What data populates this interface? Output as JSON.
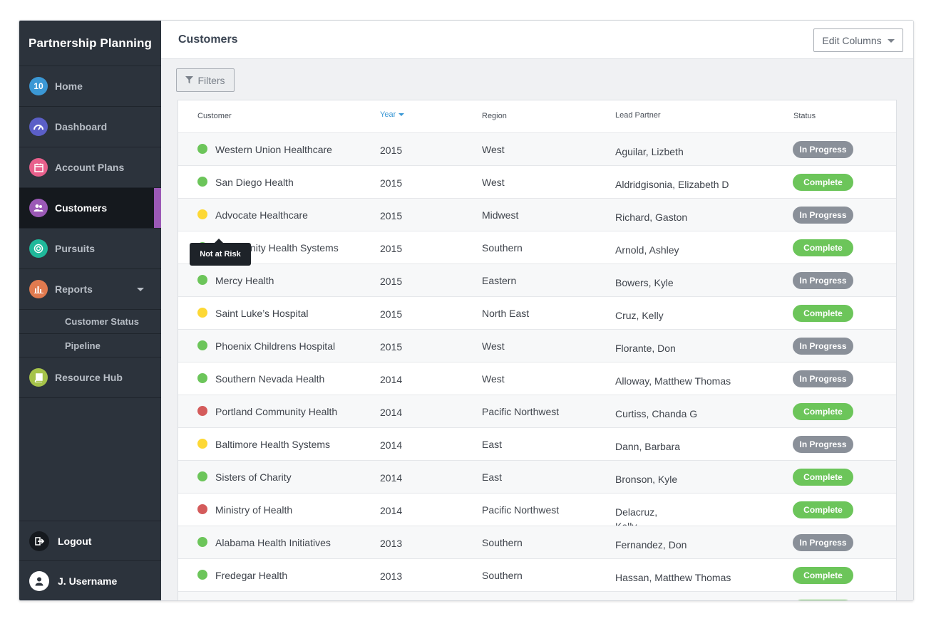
{
  "brand": "Partnership Planning",
  "nav": {
    "home": {
      "label": "Home",
      "badge": "10",
      "color": "#3b98d5"
    },
    "dashboard": {
      "label": "Dashboard",
      "color": "#5b5fc7"
    },
    "account_plans": {
      "label": "Account Plans",
      "color": "#e8608c"
    },
    "customers": {
      "label": "Customers",
      "color": "#9b59b6"
    },
    "pursuits": {
      "label": "Pursuits",
      "color": "#1fb89a"
    },
    "reports": {
      "label": "Reports",
      "color": "#e07a4f",
      "subitems": [
        "Customer Status",
        "Pipeline"
      ]
    },
    "resource_hub": {
      "label": "Resource Hub",
      "color": "#a6c34a"
    }
  },
  "bottom": {
    "logout": "Logout",
    "username": "J. Username"
  },
  "header": {
    "title": "Customers",
    "edit_columns": "Edit Columns"
  },
  "filters_label": "Filters",
  "columns": {
    "customer": "Customer",
    "year": "Year",
    "region": "Region",
    "lead_partner": "Lead Partner",
    "status": "Status"
  },
  "tooltip": "Not at Risk",
  "status_colors": {
    "In Progress": "#8a9099",
    "Complete": "#6cc55a"
  },
  "risk_colors": {
    "green": "#6cc55a",
    "yellow": "#fdd835",
    "red": "#d45b5b"
  },
  "rows": [
    {
      "risk": "green",
      "customer": "Western Union Healthcare",
      "year": "2015",
      "region": "West",
      "lead": "Aguilar, Lizbeth",
      "status": "In Progress"
    },
    {
      "risk": "green",
      "customer": "San Diego Health",
      "year": "2015",
      "region": "West",
      "lead": "Aldridgisonia, Elizabeth D",
      "status": "Complete"
    },
    {
      "risk": "yellow",
      "customer": "Advocate Healthcare",
      "year": "2015",
      "region": "Midwest",
      "lead": "Richard, Gaston",
      "status": "In Progress"
    },
    {
      "risk": "green",
      "customer": "Community Health Systems",
      "year": "2015",
      "region": "Southern",
      "lead": "Arnold, Ashley",
      "status": "Complete"
    },
    {
      "risk": "green",
      "customer": "Mercy Health",
      "year": "2015",
      "region": "Eastern",
      "lead": "Bowers, Kyle",
      "status": "In Progress"
    },
    {
      "risk": "yellow",
      "customer": "Saint Luke’s Hospital",
      "year": "2015",
      "region": "North East",
      "lead": "Cruz, Kelly",
      "status": "Complete"
    },
    {
      "risk": "green",
      "customer": "Phoenix Childrens Hospital",
      "year": "2015",
      "region": "West",
      "lead": "Florante, Don",
      "status": "In Progress"
    },
    {
      "risk": "green",
      "customer": "Southern Nevada Health",
      "year": "2014",
      "region": "West",
      "lead": "Alloway, Matthew Thomas",
      "status": "In Progress"
    },
    {
      "risk": "red",
      "customer": "Portland Community Health",
      "year": "2014",
      "region": "Pacific Northwest",
      "lead": "Curtiss, Chanda G",
      "status": "Complete"
    },
    {
      "risk": "yellow",
      "customer": "Baltimore Health Systems",
      "year": "2014",
      "region": "East",
      "lead": "Dann, Barbara",
      "status": "In Progress"
    },
    {
      "risk": "green",
      "customer": "Sisters of Charity",
      "year": "2014",
      "region": "East",
      "lead": "Bronson, Kyle",
      "status": "Complete"
    },
    {
      "risk": "red",
      "customer": "Ministry of Health",
      "year": "2014",
      "region": "Pacific Northwest",
      "lead": "Delacruz,\nKelly",
      "status": "Complete"
    },
    {
      "risk": "green",
      "customer": "Alabama Health Initiatives",
      "year": "2013",
      "region": "Southern",
      "lead": "Fernandez, Don",
      "status": "In Progress"
    },
    {
      "risk": "green",
      "customer": "Fredegar Health",
      "year": "2013",
      "region": "Southern",
      "lead": "Hassan, Matthew Thomas",
      "status": "Complete"
    },
    {
      "risk": "green",
      "customer": "",
      "year": "",
      "region": "",
      "lead": "",
      "status": "Complete"
    }
  ]
}
